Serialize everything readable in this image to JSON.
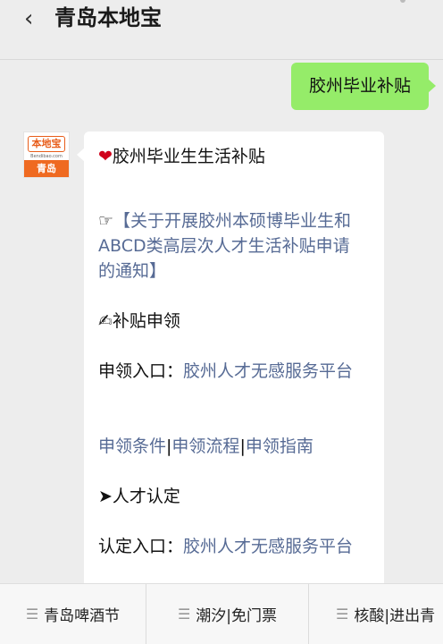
{
  "header": {
    "back_icon": "‹",
    "title": "青岛本地宝"
  },
  "outgoing": {
    "text": "胶州毕业补贴"
  },
  "avatar": {
    "brand": "本地宝",
    "site": "Bendibao.com",
    "city": "青岛"
  },
  "message": {
    "heading_icon": "heart-icon",
    "heading": "胶州毕业生生活补贴",
    "notice_icon": "☞",
    "notice_link": "【关于开展胶州本硕博毕业生和ABCD类高层次人才生活补贴申请的通知】",
    "section1_icon": "✍",
    "section1": "补贴申领",
    "apply_label": "申领入口：",
    "apply_link": "胶州人才无感服务平台",
    "link_conditions": "申领条件",
    "link_process": "申领流程",
    "link_guide": "申领指南",
    "divider": "|",
    "section2_icon": "➤",
    "section2": "人才认定",
    "recognize_label": "认定入口：",
    "recognize_link": "胶州人才无感服务平台"
  },
  "bottom_menu": {
    "item1": "青岛啤酒节",
    "item2": "潮汐|免门票",
    "item3": "核酸|进出青"
  },
  "colors": {
    "link": "#576b95",
    "bubble_out": "#95ec69",
    "brand": "#ef6a21"
  }
}
